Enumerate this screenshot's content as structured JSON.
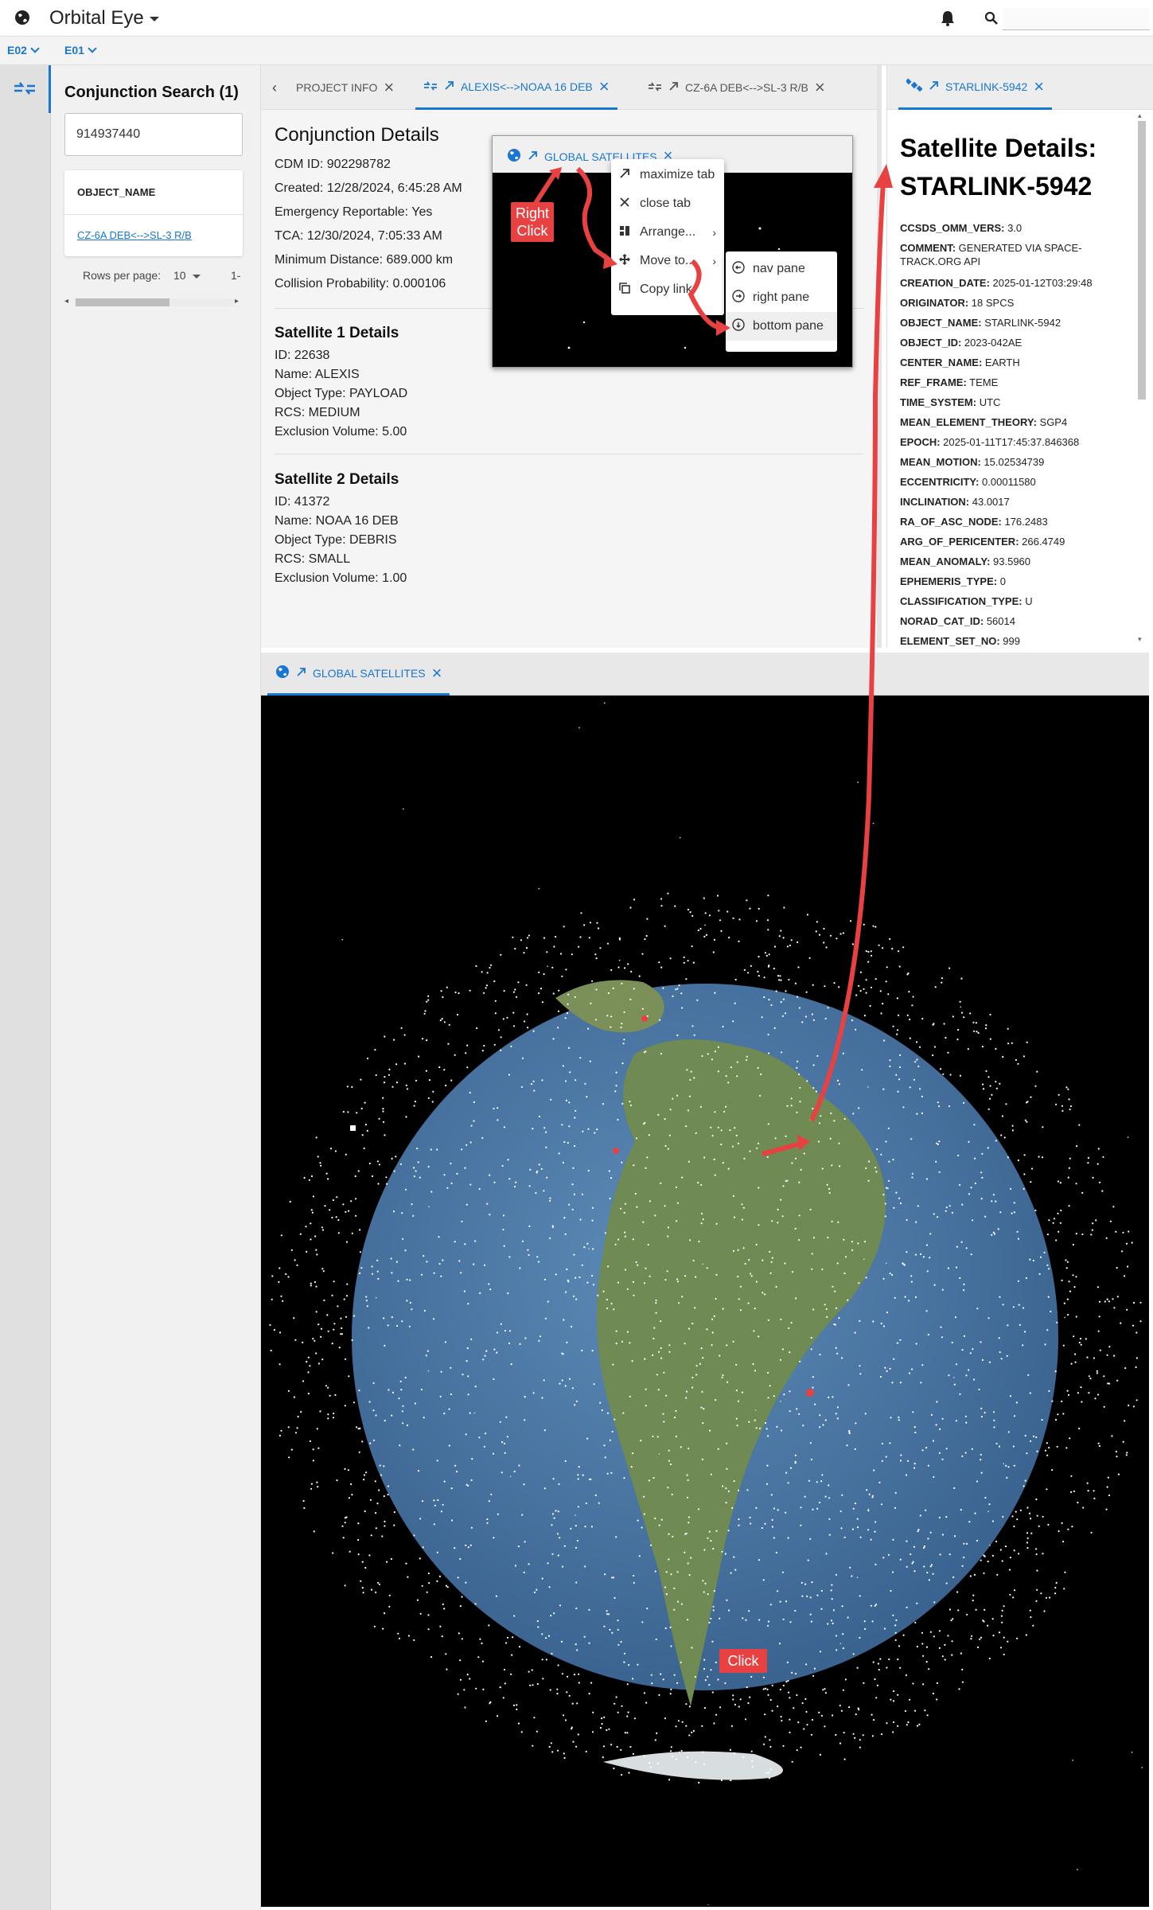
{
  "app": {
    "title": "Orbital Eye",
    "search_placeholder": ""
  },
  "env": [
    "E02",
    "E01"
  ],
  "nav": {
    "title": "Conjunction Search (1)",
    "search_value": "914937440",
    "column": "OBJECT_NAME",
    "row": "CZ-6A DEB<-->SL-3 R/B",
    "rows_per_page_label": "Rows per page:",
    "rows_per_page_value": "10",
    "range": "1-"
  },
  "tabs": [
    {
      "label": "PROJECT INFO",
      "active": false
    },
    {
      "label": "ALEXIS<-->NOAA 16 DEB",
      "active": true
    },
    {
      "label": "CZ-6A DEB<-->SL-3 R/B",
      "active": false
    }
  ],
  "conjunction": {
    "heading": "Conjunction Details",
    "lines": [
      "CDM ID: 902298782",
      "Created: 12/28/2024, 6:45:28 AM",
      "Emergency Reportable: Yes",
      "TCA: 12/30/2024, 7:05:33 AM",
      "Minimum Distance: 689.000 km",
      "Collision Probability: 0.000106"
    ],
    "sat1_heading": "Satellite 1 Details",
    "sat1": [
      "ID: 22638",
      "Name: ALEXIS",
      "Object Type: PAYLOAD",
      "RCS: MEDIUM",
      "Exclusion Volume: 5.00"
    ],
    "sat2_heading": "Satellite 2 Details",
    "sat2": [
      "ID: 41372",
      "Name: NOAA 16 DEB",
      "Object Type: DEBRIS",
      "RCS: SMALL",
      "Exclusion Volume: 1.00"
    ]
  },
  "mini_tab": {
    "label": "GLOBAL SATELLITES"
  },
  "context_menu": {
    "items": [
      "maximize tab",
      "close tab",
      "Arrange...",
      "Move to...",
      "Copy link"
    ],
    "submenu": [
      "nav pane",
      "right pane",
      "bottom pane"
    ]
  },
  "callouts": {
    "right_click": "Right Click",
    "click": "Click"
  },
  "right": {
    "tab_label": "STARLINK-5942",
    "title_line1": "Satellite Details:",
    "title_line2": "STARLINK-5942",
    "fields": [
      {
        "k": "CCSDS_OMM_VERS:",
        "v": "3.0"
      },
      {
        "k": "COMMENT:",
        "v": "GENERATED VIA SPACE-TRACK.ORG API"
      },
      {
        "k": "CREATION_DATE:",
        "v": "2025-01-12T03:29:48"
      },
      {
        "k": "ORIGINATOR:",
        "v": "18 SPCS"
      },
      {
        "k": "OBJECT_NAME:",
        "v": "STARLINK-5942"
      },
      {
        "k": "OBJECT_ID:",
        "v": "2023-042AE"
      },
      {
        "k": "CENTER_NAME:",
        "v": "EARTH"
      },
      {
        "k": "REF_FRAME:",
        "v": "TEME"
      },
      {
        "k": "TIME_SYSTEM:",
        "v": "UTC"
      },
      {
        "k": "MEAN_ELEMENT_THEORY:",
        "v": "SGP4"
      },
      {
        "k": "EPOCH:",
        "v": "2025-01-11T17:45:37.846368"
      },
      {
        "k": "MEAN_MOTION:",
        "v": "15.02534739"
      },
      {
        "k": "ECCENTRICITY:",
        "v": "0.00011580"
      },
      {
        "k": "INCLINATION:",
        "v": "43.0017"
      },
      {
        "k": "RA_OF_ASC_NODE:",
        "v": "176.2483"
      },
      {
        "k": "ARG_OF_PERICENTER:",
        "v": "266.4749"
      },
      {
        "k": "MEAN_ANOMALY:",
        "v": "93.5960"
      },
      {
        "k": "EPHEMERIS_TYPE:",
        "v": "0"
      },
      {
        "k": "CLASSIFICATION_TYPE:",
        "v": "U"
      },
      {
        "k": "NORAD_CAT_ID:",
        "v": "56014"
      },
      {
        "k": "ELEMENT_SET_NO:",
        "v": "999"
      }
    ]
  },
  "bottom": {
    "tab_label": "GLOBAL SATELLITES"
  },
  "colors": {
    "accent": "#1976d2",
    "callout": "#e84142",
    "ocean": "#4a78a8",
    "land": "#6f8a52"
  },
  "icons": [
    "globe-icon",
    "bell-icon",
    "search-icon",
    "conjunction-icon",
    "external-link-icon",
    "satellite-icon",
    "close-icon"
  ]
}
